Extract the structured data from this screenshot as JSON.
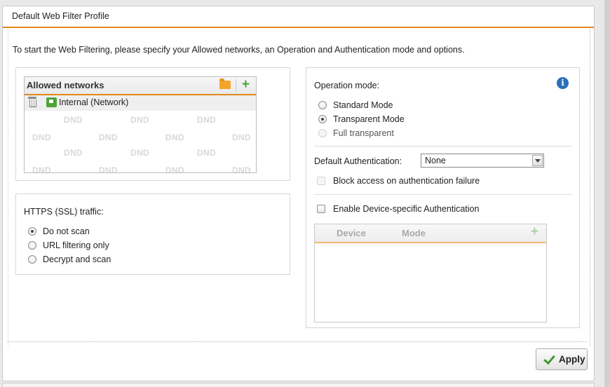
{
  "panel": {
    "title": "Default Web Filter Profile"
  },
  "intro_text": "To start the Web Filtering, please specify your Allowed networks, an Operation and Authentication mode and options.",
  "allowed_networks": {
    "header": "Allowed networks",
    "items": [
      {
        "label": "Internal (Network)"
      }
    ],
    "dnd_placeholder": "DND"
  },
  "https": {
    "label": "HTTPS (SSL) traffic:",
    "options": [
      "Do not scan",
      "URL filtering only",
      "Decrypt and scan"
    ],
    "selected": "Do not scan"
  },
  "operation": {
    "label": "Operation mode:",
    "options": [
      "Standard Mode",
      "Transparent Mode",
      "Full transparent"
    ],
    "selected": "Transparent Mode"
  },
  "auth": {
    "label": "Default Authentication:",
    "value": "None",
    "block_label": "Block access on authentication failure",
    "device_specific_label": "Enable Device-specific Authentication"
  },
  "device_table": {
    "columns": [
      "Device",
      "Mode"
    ]
  },
  "apply_label": "Apply",
  "colors": {
    "accent": "#e08a1e",
    "add_green": "#4aa33a",
    "info_blue": "#2a6fb8"
  },
  "icons": [
    "folder-icon",
    "add-icon",
    "trash-icon",
    "network-icon",
    "info-icon",
    "check-icon",
    "chevron-down-icon"
  ]
}
